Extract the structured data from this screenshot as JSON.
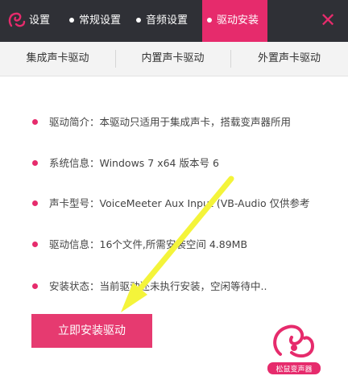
{
  "colors": {
    "accent": "#e62b6c",
    "titlebar": "#2f3036",
    "arrow": "#f4f43a"
  },
  "titlebar": {
    "logo_icon": "squirrel-logo",
    "tabs": [
      {
        "label": "设置"
      },
      {
        "label": "常规设置"
      },
      {
        "label": "音频设置"
      },
      {
        "label": "驱动安装",
        "active": true
      }
    ],
    "close_icon": "close-x"
  },
  "subtabs": [
    "集成声卡驱动",
    "内置声卡驱动",
    "外置声卡驱动"
  ],
  "info": [
    "驱动简介：本驱动只适用于集成声卡，搭载变声器所用",
    "系统信息：Windows 7  x64 版本号 6",
    "声卡型号：VoiceMeeter Aux Input (VB-Audio 仅供参考",
    "驱动信息：16个文件,所需安装空间  4.89MB",
    "安装状态：当前驱动还未执行安装，空闲等待中.."
  ],
  "install_button": "立即安装驱动",
  "brand_logo": {
    "icon": "squirrel-logo",
    "text": "松鼠变声器"
  }
}
